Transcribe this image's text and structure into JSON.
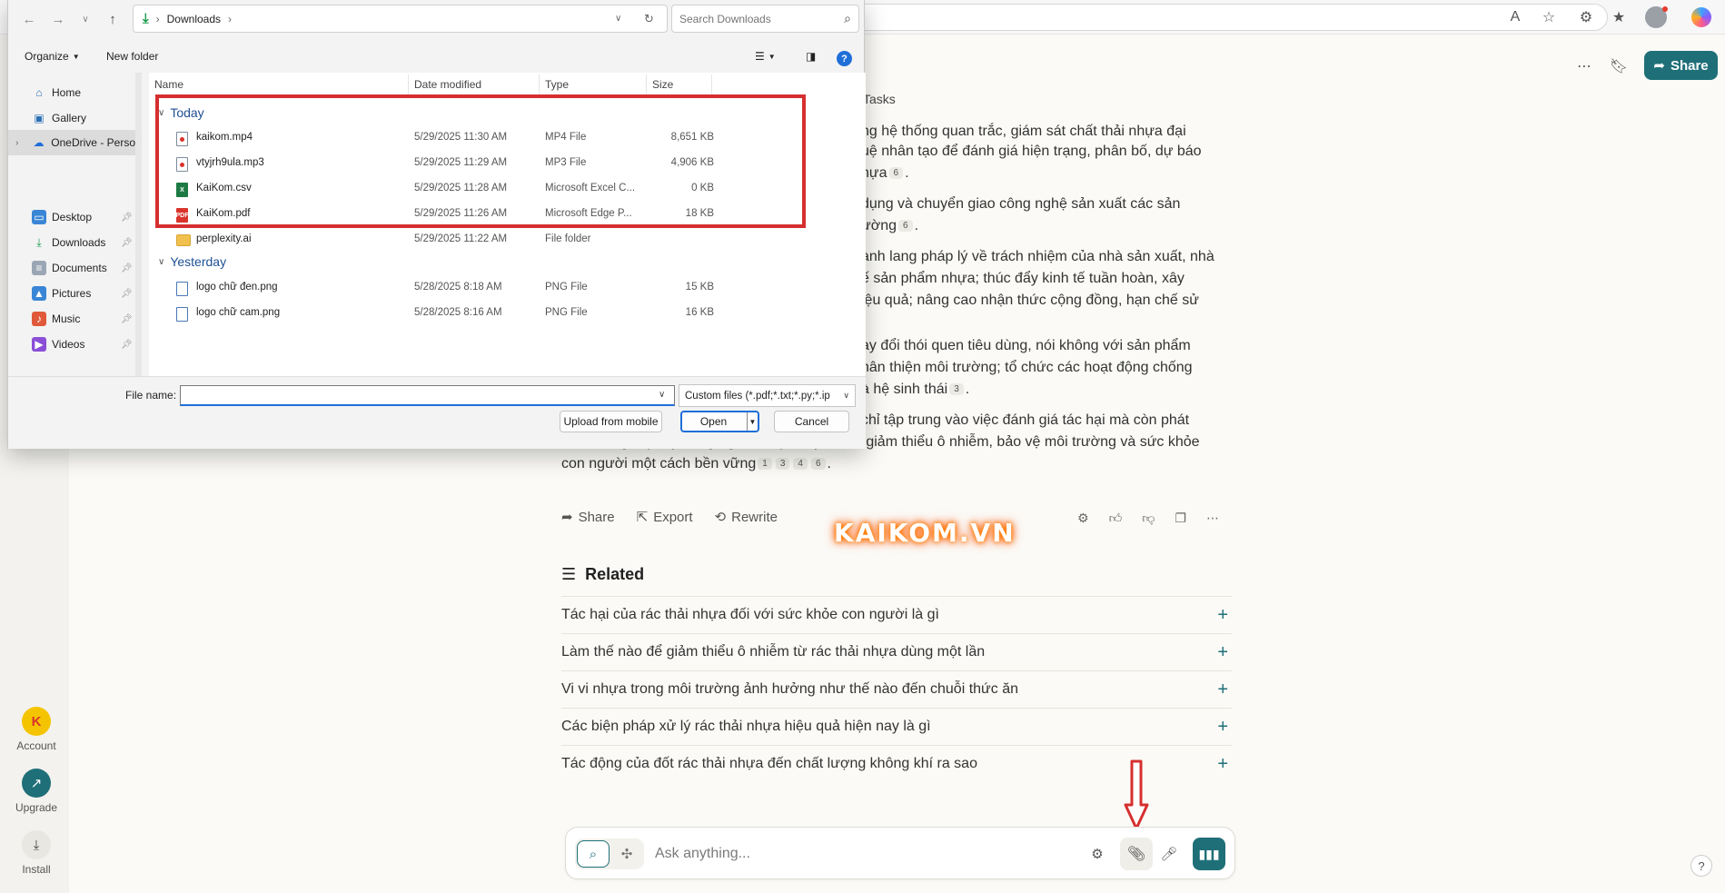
{
  "dialog": {
    "path": [
      "Downloads"
    ],
    "search_placeholder": "Search Downloads",
    "toolbar": {
      "organize": "Organize",
      "new_folder": "New folder"
    },
    "nav": [
      {
        "label": "Home",
        "icon": "home-icon"
      },
      {
        "label": "Gallery",
        "icon": "gallery-icon"
      },
      {
        "label": "OneDrive - Perso",
        "icon": "onedrive-icon"
      },
      {
        "label": "Desktop",
        "icon": "desktop-icon"
      },
      {
        "label": "Downloads",
        "icon": "download-icon"
      },
      {
        "label": "Documents",
        "icon": "documents-icon"
      },
      {
        "label": "Pictures",
        "icon": "pictures-icon"
      },
      {
        "label": "Music",
        "icon": "music-icon"
      },
      {
        "label": "Videos",
        "icon": "videos-icon"
      }
    ],
    "columns": [
      "Name",
      "Date modified",
      "Type",
      "Size"
    ],
    "groups": [
      {
        "label": "Today"
      },
      {
        "label": "Yesterday"
      }
    ],
    "files": [
      {
        "name": "kaikom.mp4",
        "date": "5/29/2025 11:30 AM",
        "type": "MP4 File",
        "size": "8,651 KB"
      },
      {
        "name": "vtyjrh9ula.mp3",
        "date": "5/29/2025 11:29 AM",
        "type": "MP3 File",
        "size": "4,906 KB"
      },
      {
        "name": "KaiKom.csv",
        "date": "5/29/2025 11:28 AM",
        "type": "Microsoft Excel C...",
        "size": "0 KB"
      },
      {
        "name": "KaiKom.pdf",
        "date": "5/29/2025 11:26 AM",
        "type": "Microsoft Edge P...",
        "size": "18 KB"
      },
      {
        "name": "perplexity.ai",
        "date": "5/29/2025 11:22 AM",
        "type": "File folder",
        "size": ""
      },
      {
        "name": "logo chữ đen.png",
        "date": "5/28/2025 8:18 AM",
        "type": "PNG File",
        "size": "15 KB"
      },
      {
        "name": "logo chữ cam.png",
        "date": "5/28/2025 8:16 AM",
        "type": "PNG File",
        "size": "16 KB"
      }
    ],
    "file_name_label": "File name:",
    "file_name_value": "",
    "filter": "Custom files (*.pdf;*.txt;*.py;*.ip",
    "upload_from_mobile": "Upload from mobile",
    "open": "Open",
    "cancel": "Cancel"
  },
  "rail": {
    "account": "Account",
    "upgrade": "Upgrade",
    "install": "Install"
  },
  "page": {
    "share": "Share",
    "tasks": "Tasks",
    "answer_lines": [
      {
        "text": "ng hệ thống quan trắc, giám sát chất thải nhựa đại",
        "cites": []
      },
      {
        "text": "uệ nhân tạo để đánh giá hiện trạng, phân bố, dự báo",
        "cites": []
      },
      {
        "text": "hựa",
        "cites": [
          "6"
        ]
      },
      {
        "text": "dụng và chuyển giao công nghệ sản xuất các sản",
        "cites": []
      },
      {
        "text": "ường",
        "cites": [
          "6"
        ]
      },
      {
        "text": "ành lang pháp lý về trách nhiệm của nhà sản xuất, nhà",
        "cites": []
      },
      {
        "text": "ế sản phẩm nhựa; thúc đẩy kinh tế tuần hoàn, xây",
        "cites": []
      },
      {
        "text": "iệu quả; nâng cao nhận thức cộng đồng, hạn chế sử",
        "cites": []
      },
      {
        "text": "ay đổi thói quen tiêu dùng, nói không với sản phẩm",
        "cites": []
      },
      {
        "text": "hân thiện môi trường; tổ chức các hoạt động chống",
        "cites": []
      },
      {
        "text": "à hệ sinh thái",
        "cites": [
          "3"
        ]
      },
      {
        "text": "chỉ tập trung vào việc đánh giá tác hại mà còn phát",
        "cites": []
      },
      {
        "text": "triển các giải pháp công nghệ và quản lý nhằm giảm thiểu ô nhiễm, bảo vệ môi trường và sức khỏe",
        "cites": []
      },
      {
        "text": "con người một cách bền vững",
        "cites": [
          "1",
          "3",
          "4",
          "6"
        ]
      }
    ],
    "actions": {
      "share": "Share",
      "export": "Export",
      "rewrite": "Rewrite"
    },
    "watermark": "KAIKOM.VN",
    "related_title": "Related",
    "related": [
      "Tác hại của rác thải nhựa đối với sức khỏe con người là gì",
      "Làm thế nào để giảm thiểu ô nhiễm từ rác thải nhựa dùng một lần",
      "Vi vi nhựa trong môi trường ảnh hưởng như thế nào đến chuỗi thức ăn",
      "Các biện pháp xử lý rác thải nhựa hiệu quả hiện nay là gì",
      "Tác động của đốt rác thải nhựa đến chất lượng không khí ra sao"
    ],
    "ask_placeholder": "Ask anything...",
    "help": "?"
  },
  "colors": {
    "accent": "#1f6f78",
    "highlight": "#d62f2f",
    "dialog_accent": "#1f6fd8"
  }
}
